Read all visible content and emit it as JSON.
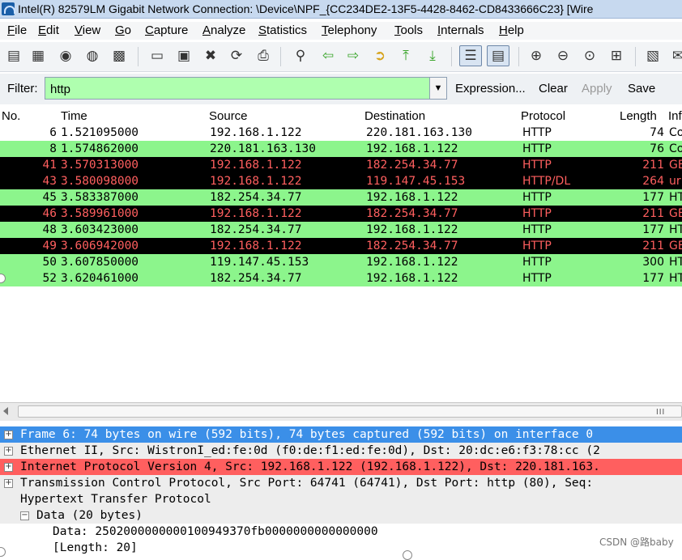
{
  "window": {
    "title": "Intel(R) 82579LM Gigabit Network Connection: \\Device\\NPF_{CC234DE2-13F5-4428-8462-CD8433666C23}   [Wire"
  },
  "menu": [
    "File",
    "Edit",
    "View",
    "Go",
    "Capture",
    "Analyze",
    "Statistics",
    "Telephony",
    "Tools",
    "Internals",
    "Help"
  ],
  "toolbar_icons": [
    "interface-list-icon",
    "capture-options-icon",
    "start-capture-icon",
    "stop-capture-icon",
    "restart-capture-icon",
    "open-file-icon",
    "save-file-icon",
    "close-file-icon",
    "reload-icon",
    "print-icon",
    "find-packet-icon",
    "go-back-icon",
    "go-forward-icon",
    "go-to-packet-icon",
    "go-first-icon",
    "go-last-icon",
    "colorize-icon",
    "auto-scroll-icon",
    "zoom-in-icon",
    "zoom-out-icon",
    "zoom-normal-icon",
    "resize-columns-icon",
    "capture-filters-icon",
    "display-filters-icon"
  ],
  "filter": {
    "label": "Filter:",
    "value": "http",
    "expression": "Expression...",
    "clear": "Clear",
    "apply": "Apply",
    "save": "Save"
  },
  "columns": {
    "no": "No.",
    "time": "Time",
    "source": "Source",
    "destination": "Destination",
    "protocol": "Protocol",
    "length": "Length",
    "info": "Inf"
  },
  "packets": [
    {
      "no": "6",
      "time": "1.521095000",
      "source": "192.168.1.122",
      "destination": "220.181.163.130",
      "protocol": "HTTP",
      "length": "74",
      "info": "Co",
      "color": "white"
    },
    {
      "no": "8",
      "time": "1.574862000",
      "source": "220.181.163.130",
      "destination": "192.168.1.122",
      "protocol": "HTTP",
      "length": "76",
      "info": "Co",
      "color": "green"
    },
    {
      "no": "41",
      "time": "3.570313000",
      "source": "192.168.1.122",
      "destination": "182.254.34.77",
      "protocol": "HTTP",
      "length": "211",
      "info": "GE",
      "color": "black"
    },
    {
      "no": "43",
      "time": "3.580098000",
      "source": "192.168.1.122",
      "destination": "119.147.45.153",
      "protocol": "HTTP/DL",
      "length": "264",
      "info": "ur",
      "color": "dark"
    },
    {
      "no": "45",
      "time": "3.583387000",
      "source": "182.254.34.77",
      "destination": "192.168.1.122",
      "protocol": "HTTP",
      "length": "177",
      "info": "HT",
      "color": "green"
    },
    {
      "no": "46",
      "time": "3.589961000",
      "source": "192.168.1.122",
      "destination": "182.254.34.77",
      "protocol": "HTTP",
      "length": "211",
      "info": "GE",
      "color": "black"
    },
    {
      "no": "48",
      "time": "3.603423000",
      "source": "182.254.34.77",
      "destination": "192.168.1.122",
      "protocol": "HTTP",
      "length": "177",
      "info": "HT",
      "color": "green"
    },
    {
      "no": "49",
      "time": "3.606942000",
      "source": "192.168.1.122",
      "destination": "182.254.34.77",
      "protocol": "HTTP",
      "length": "211",
      "info": "GE",
      "color": "black"
    },
    {
      "no": "50",
      "time": "3.607850000",
      "source": "119.147.45.153",
      "destination": "192.168.1.122",
      "protocol": "HTTP",
      "length": "300",
      "info": "HT",
      "color": "green"
    },
    {
      "no": "52",
      "time": "3.620461000",
      "source": "182.254.34.77",
      "destination": "192.168.1.122",
      "protocol": "HTTP",
      "length": "177",
      "info": "HT",
      "color": "green"
    }
  ],
  "details": [
    {
      "text": "Frame 6: 74 bytes on wire (592 bits), 74 bytes captured (592 bits) on interface 0",
      "expander": "+",
      "indent": 0,
      "style": "sel"
    },
    {
      "text": "Ethernet II, Src: WistronI_ed:fe:0d (f0:de:f1:ed:fe:0d), Dst: 20:dc:e6:f3:78:cc (2",
      "expander": "+",
      "indent": 0,
      "style": "gray"
    },
    {
      "text": "Internet Protocol Version 4, Src: 192.168.1.122 (192.168.1.122), Dst: 220.181.163.",
      "expander": "+",
      "indent": 0,
      "style": "red"
    },
    {
      "text": "Transmission Control Protocol, Src Port: 64741 (64741), Dst Port: http (80), Seq:",
      "expander": "+",
      "indent": 0,
      "style": "gray"
    },
    {
      "text": "Hypertext Transfer Protocol",
      "expander": "",
      "indent": 0,
      "style": "gray"
    },
    {
      "text": "Data (20 bytes)",
      "expander": "−",
      "indent": 1,
      "style": "gray"
    },
    {
      "text": "Data: 2502000000000100949370fb0000000000000000",
      "expander": "",
      "indent": 2,
      "style": "plain"
    },
    {
      "text": "[Length: 20]",
      "expander": "",
      "indent": 2,
      "style": "plain"
    }
  ],
  "scrollbar_grip": "III",
  "watermark": "CSDN @路baby",
  "colors": {
    "green_row": "#8cf58c",
    "black_row": "#000000",
    "black_row_text": "#ff5f5f",
    "selected": "#3b8fe8",
    "filter_bg": "#afffaf"
  }
}
